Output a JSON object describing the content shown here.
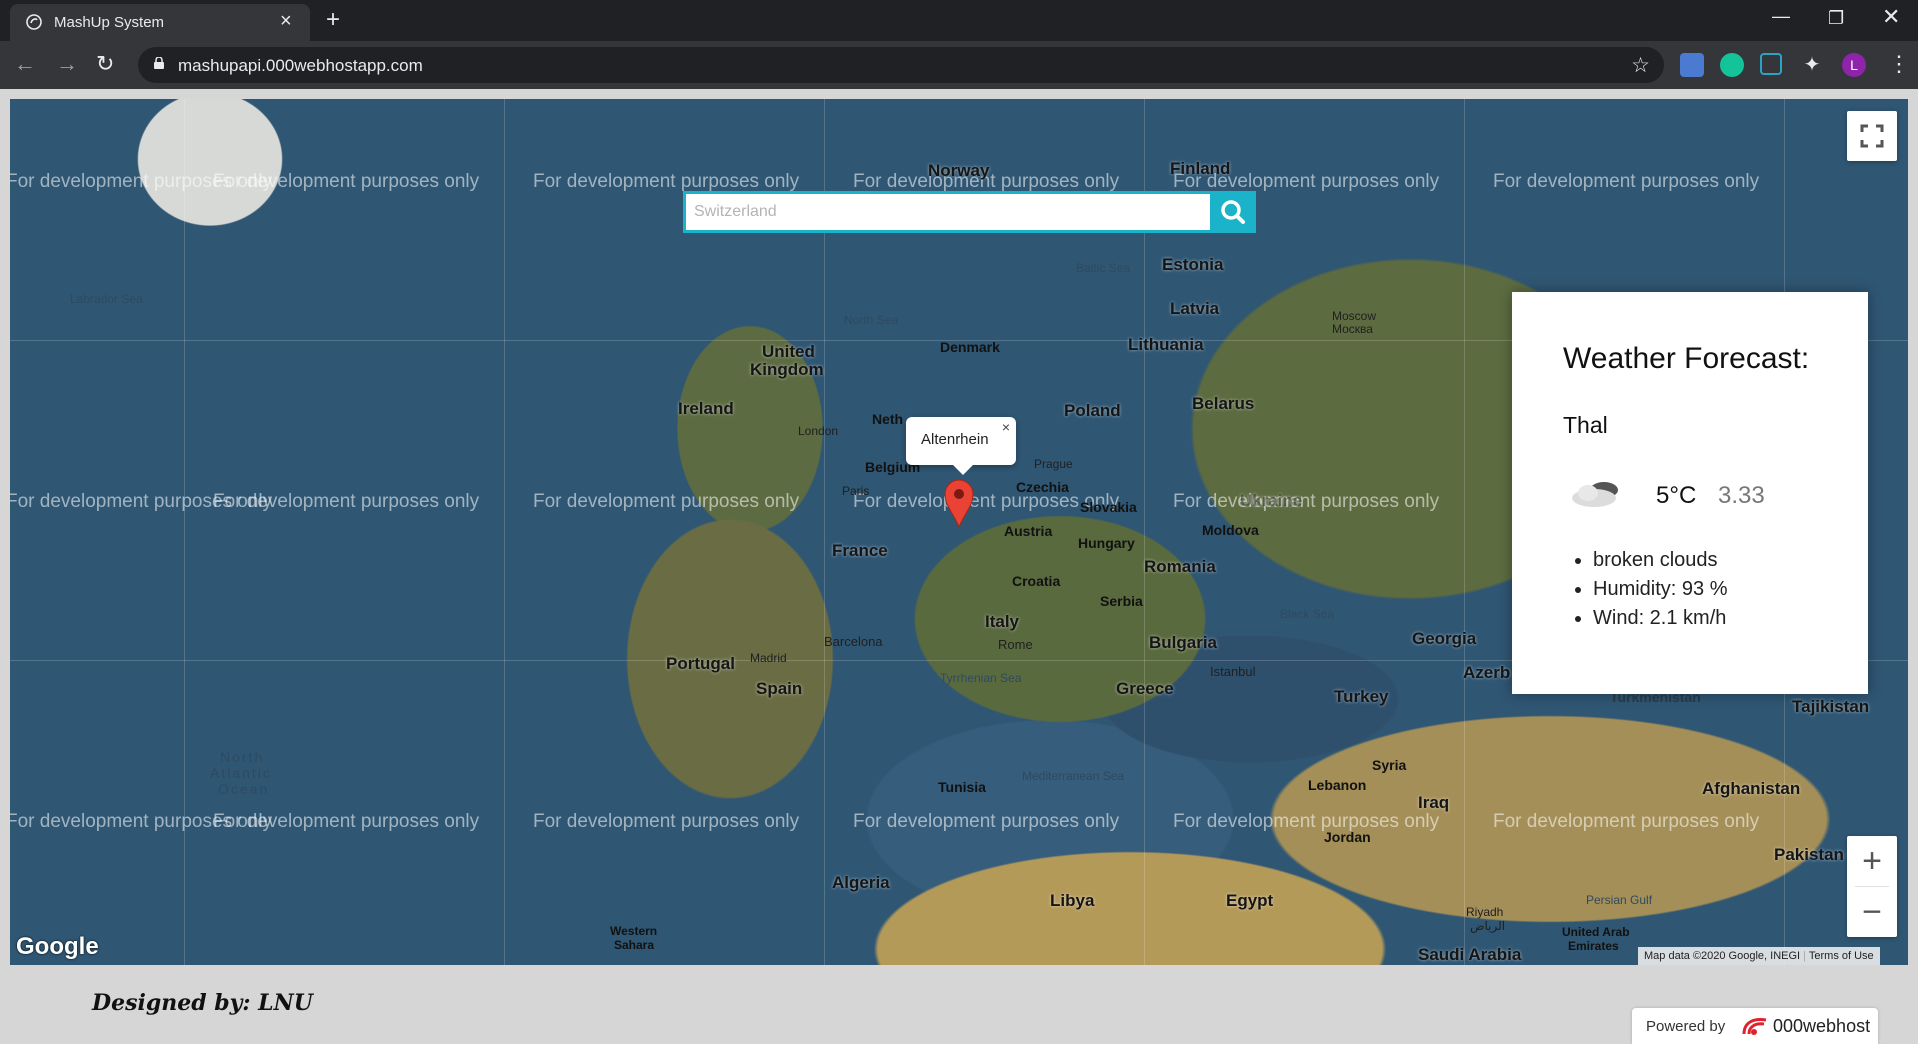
{
  "browser": {
    "tab_title": "MashUp System",
    "url": "mashupapi.000webhostapp.com",
    "profile_initial": "L",
    "icons": [
      "back-icon",
      "forward-icon",
      "reload-icon",
      "lock-icon",
      "star-icon",
      "translate-icon",
      "grammarly-icon",
      "extension-n-icon",
      "puzzle-icon"
    ]
  },
  "map": {
    "watermark": "For development purposes only",
    "search": {
      "value": "",
      "placeholder": "Switzerland"
    },
    "popup": {
      "text": "Altenrhein",
      "close": "×"
    },
    "labels": {
      "norway": "Norway",
      "finland": "Finland",
      "estonia": "Estonia",
      "latvia": "Latvia",
      "lithuania": "Lithuania",
      "denmark": "Denmark",
      "united_kingdom_1": "United",
      "united_kingdom_2": "Kingdom",
      "ireland": "Ireland",
      "poland": "Poland",
      "belarus": "Belarus",
      "moscow": "Moscow",
      "moscow_ru": "Москва",
      "netherlands": "Neth",
      "belgium": "Belgium",
      "london": "London",
      "paris": "Paris",
      "prague": "Prague",
      "czechia": "Czechia",
      "slovakia": "Slovakia",
      "austria": "Austria",
      "hungary": "Hungary",
      "moldova": "Moldova",
      "ukraine": "Ukraine",
      "romania": "Romania",
      "france": "France",
      "croatia": "Croatia",
      "serbia": "Serbia",
      "italy": "Italy",
      "rome": "Rome",
      "bulgaria": "Bulgaria",
      "barcelona": "Barcelona",
      "portugal": "Portugal",
      "madrid": "Madrid",
      "spain": "Spain",
      "georgia": "Georgia",
      "azerb": "Azerb",
      "turkey": "Turkey",
      "istanbul": "Istanbul",
      "greece": "Greece",
      "tunisia": "Tunisia",
      "syria": "Syria",
      "lebanon": "Lebanon",
      "iraq": "Iraq",
      "jordan": "Jordan",
      "algeria": "Algeria",
      "libya": "Libya",
      "egypt": "Egypt",
      "western_sahara_1": "Western",
      "western_sahara_2": "Sahara",
      "saudi_arabia": "Saudi Arabia",
      "riyadh": "Riyadh",
      "riyadh_ar": "الرياض",
      "uae_1": "United Arab",
      "uae_2": "Emirates",
      "afghanistan": "Afghanistan",
      "pakistan": "Pakistan",
      "tajikistan": "Tajikistan",
      "turkmenistan": "Turkmenistan",
      "baltic_sea": "Baltic Sea",
      "north_sea": "North Sea",
      "labrador_sea": "Labrador Sea",
      "black_sea": "Black Sea",
      "tyrrhenian_sea": "Tyrrhenian Sea",
      "mediterranean_sea": "Mediterranean Sea",
      "persian_gulf": "Persian Gulf",
      "north_atlantic_1": "North",
      "north_atlantic_2": "Atlantic",
      "north_atlantic_3": "Ocean"
    },
    "attribution": "Map data ©2020 Google, INEGI",
    "terms": "Terms of Use",
    "google_logo": "Google",
    "controls": {
      "zoom_in": "+",
      "zoom_out": "−"
    }
  },
  "weather": {
    "heading": "Weather Forecast:",
    "city": "Thal",
    "temperature": "5°C",
    "value": "3.33",
    "details": [
      "broken clouds",
      "Humidity: 93 %",
      "Wind: 2.1 km/h"
    ]
  },
  "footer": {
    "designed_by": "Designed by: LNU",
    "powered_by": "Powered by",
    "host": "000webhost"
  }
}
